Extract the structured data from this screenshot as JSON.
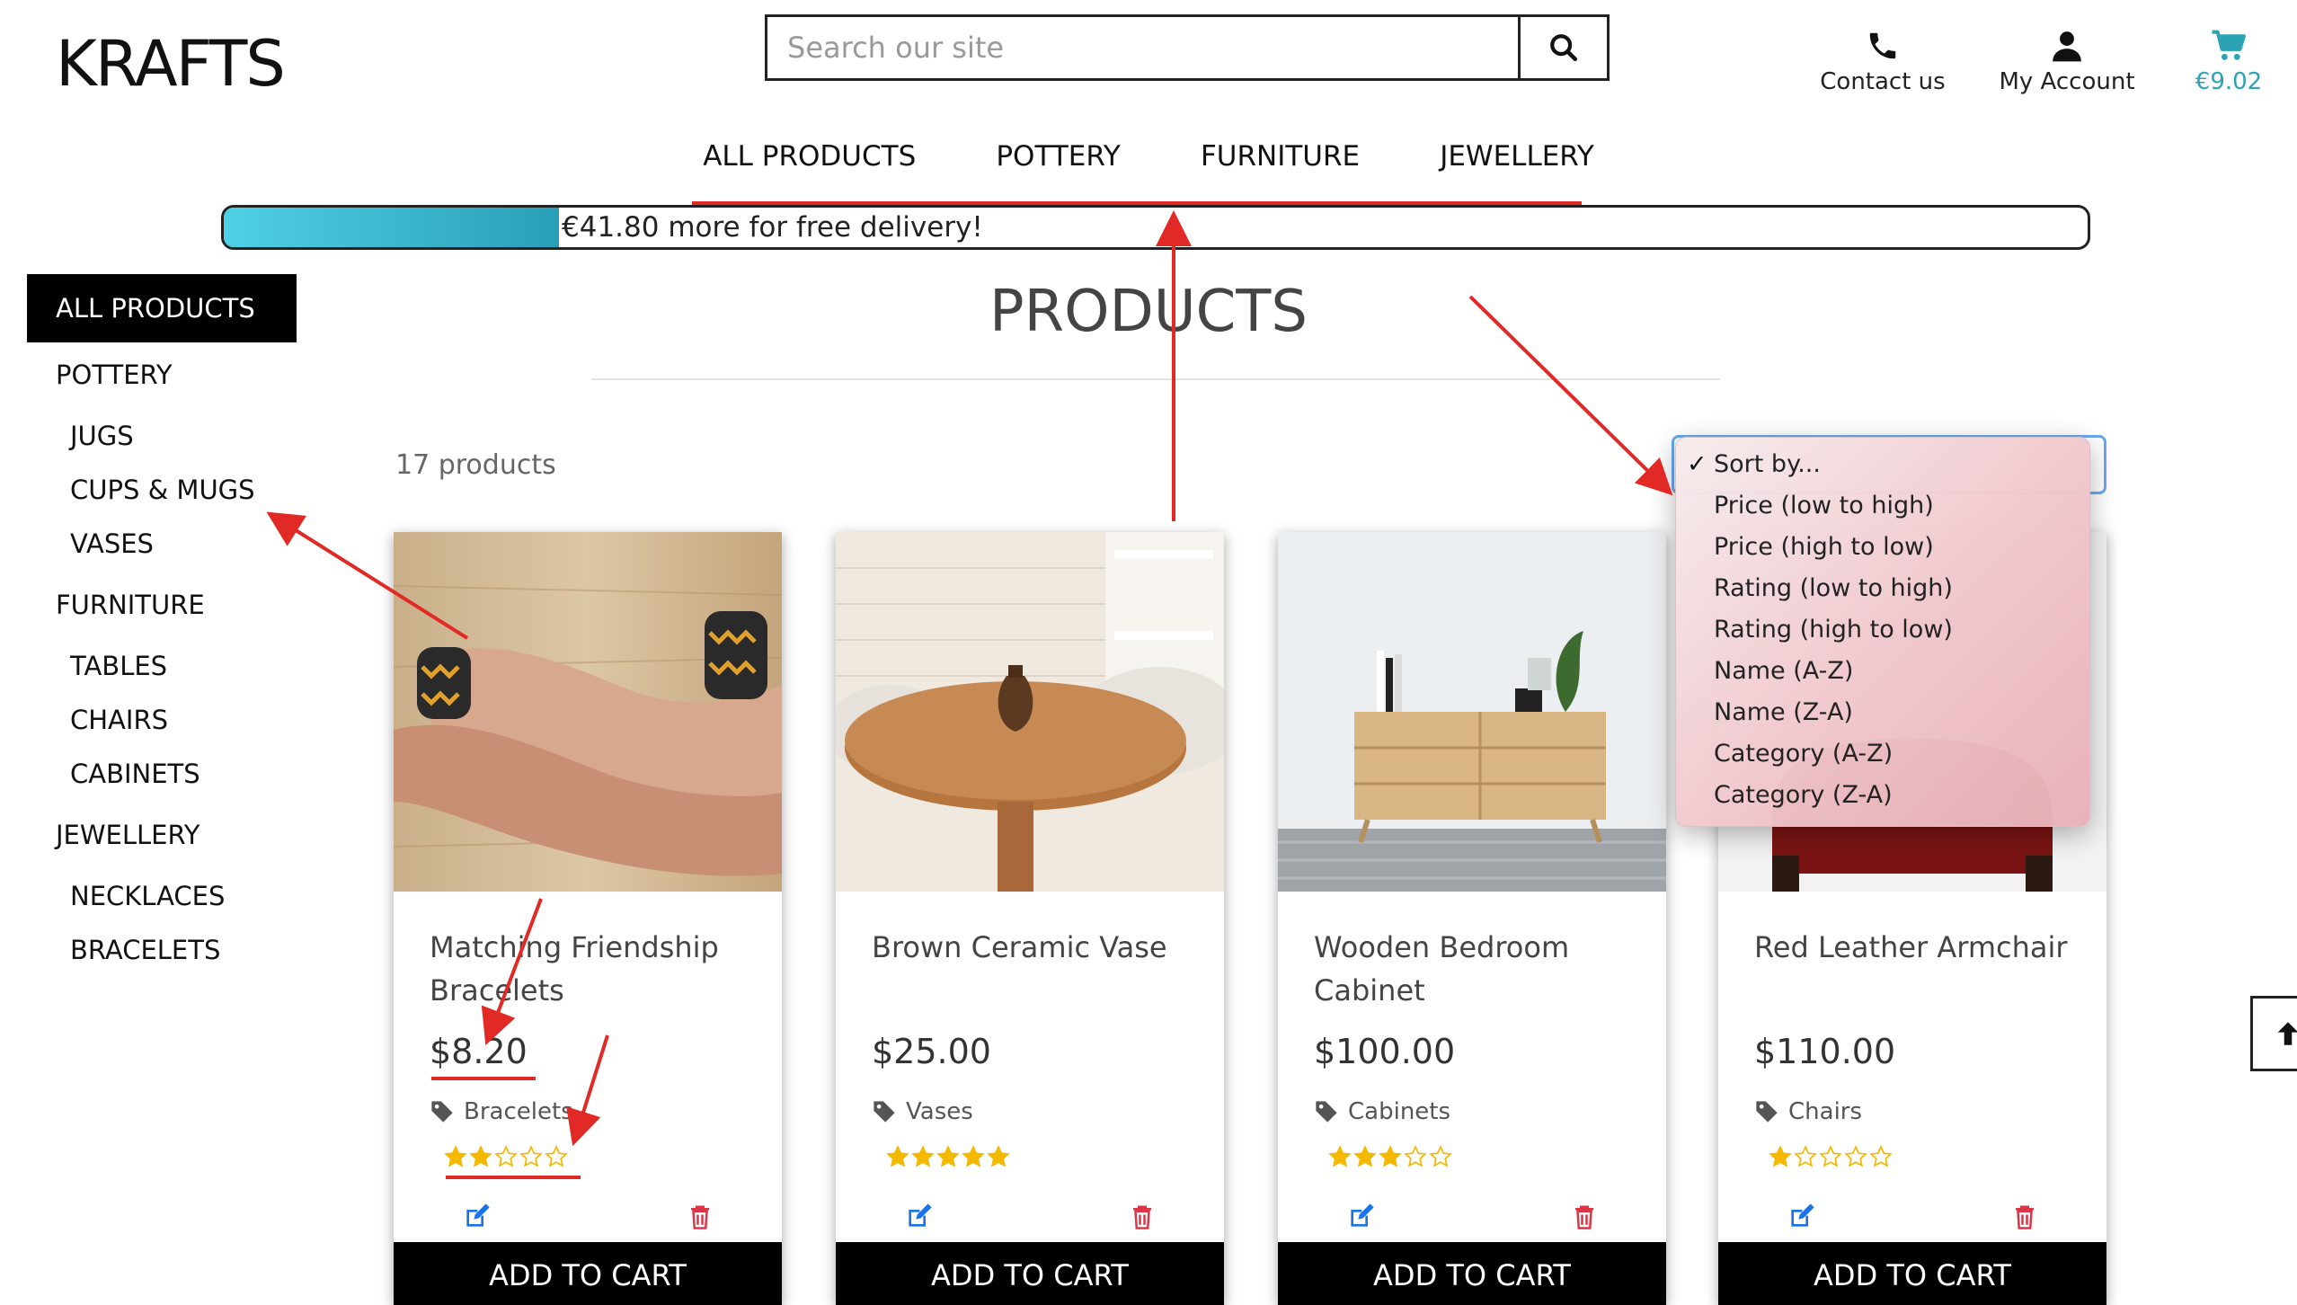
{
  "header": {
    "logo": "KRAFTS",
    "search_placeholder": "Search our site",
    "contact_label": "Contact us",
    "account_label": "My Account",
    "cart_amount": "€9.02"
  },
  "nav": {
    "items": [
      "ALL PRODUCTS",
      "POTTERY",
      "FURNITURE",
      "JEWELLERY"
    ]
  },
  "delivery": {
    "message": "€41.80 more for free delivery!",
    "progress_fraction": 0.18
  },
  "sidebar": {
    "active": "ALL PRODUCTS",
    "pottery": "POTTERY",
    "pottery_items": [
      "JUGS",
      "CUPS & MUGS",
      "VASES"
    ],
    "furniture": "FURNITURE",
    "furniture_items": [
      "TABLES",
      "CHAIRS",
      "CABINETS"
    ],
    "jewellery": "JEWELLERY",
    "jewellery_items": [
      "NECKLACES",
      "BRACELETS"
    ]
  },
  "main": {
    "title": "PRODUCTS",
    "count": "17 products"
  },
  "sort": {
    "options": [
      "Sort by...",
      "Price (low to high)",
      "Price (high to low)",
      "Rating (low to high)",
      "Rating (high to low)",
      "Name (A-Z)",
      "Name (Z-A)",
      "Category (A-Z)",
      "Category (Z-A)"
    ],
    "selected_index": 0
  },
  "products": [
    {
      "name": "Matching Friendship Bracelets",
      "price": "$8.20",
      "category": "Bracelets",
      "rating": 2,
      "cta": "ADD TO CART"
    },
    {
      "name": "Brown Ceramic Vase",
      "price": "$25.00",
      "category": "Vases",
      "rating": 5,
      "cta": "ADD TO CART"
    },
    {
      "name": "Wooden Bedroom Cabinet",
      "price": "$100.00",
      "category": "Cabinets",
      "rating": 3,
      "cta": "ADD TO CART"
    },
    {
      "name": "Red Leather Armchair",
      "price": "$110.00",
      "category": "Chairs",
      "rating": 1,
      "cta": "ADD TO CART"
    }
  ],
  "colors": {
    "accent": "#2ba3b5",
    "annotation": "#e12a25",
    "star": "#f5b800",
    "edit_icon": "#1a73e8",
    "delete_icon": "#dc3545"
  }
}
